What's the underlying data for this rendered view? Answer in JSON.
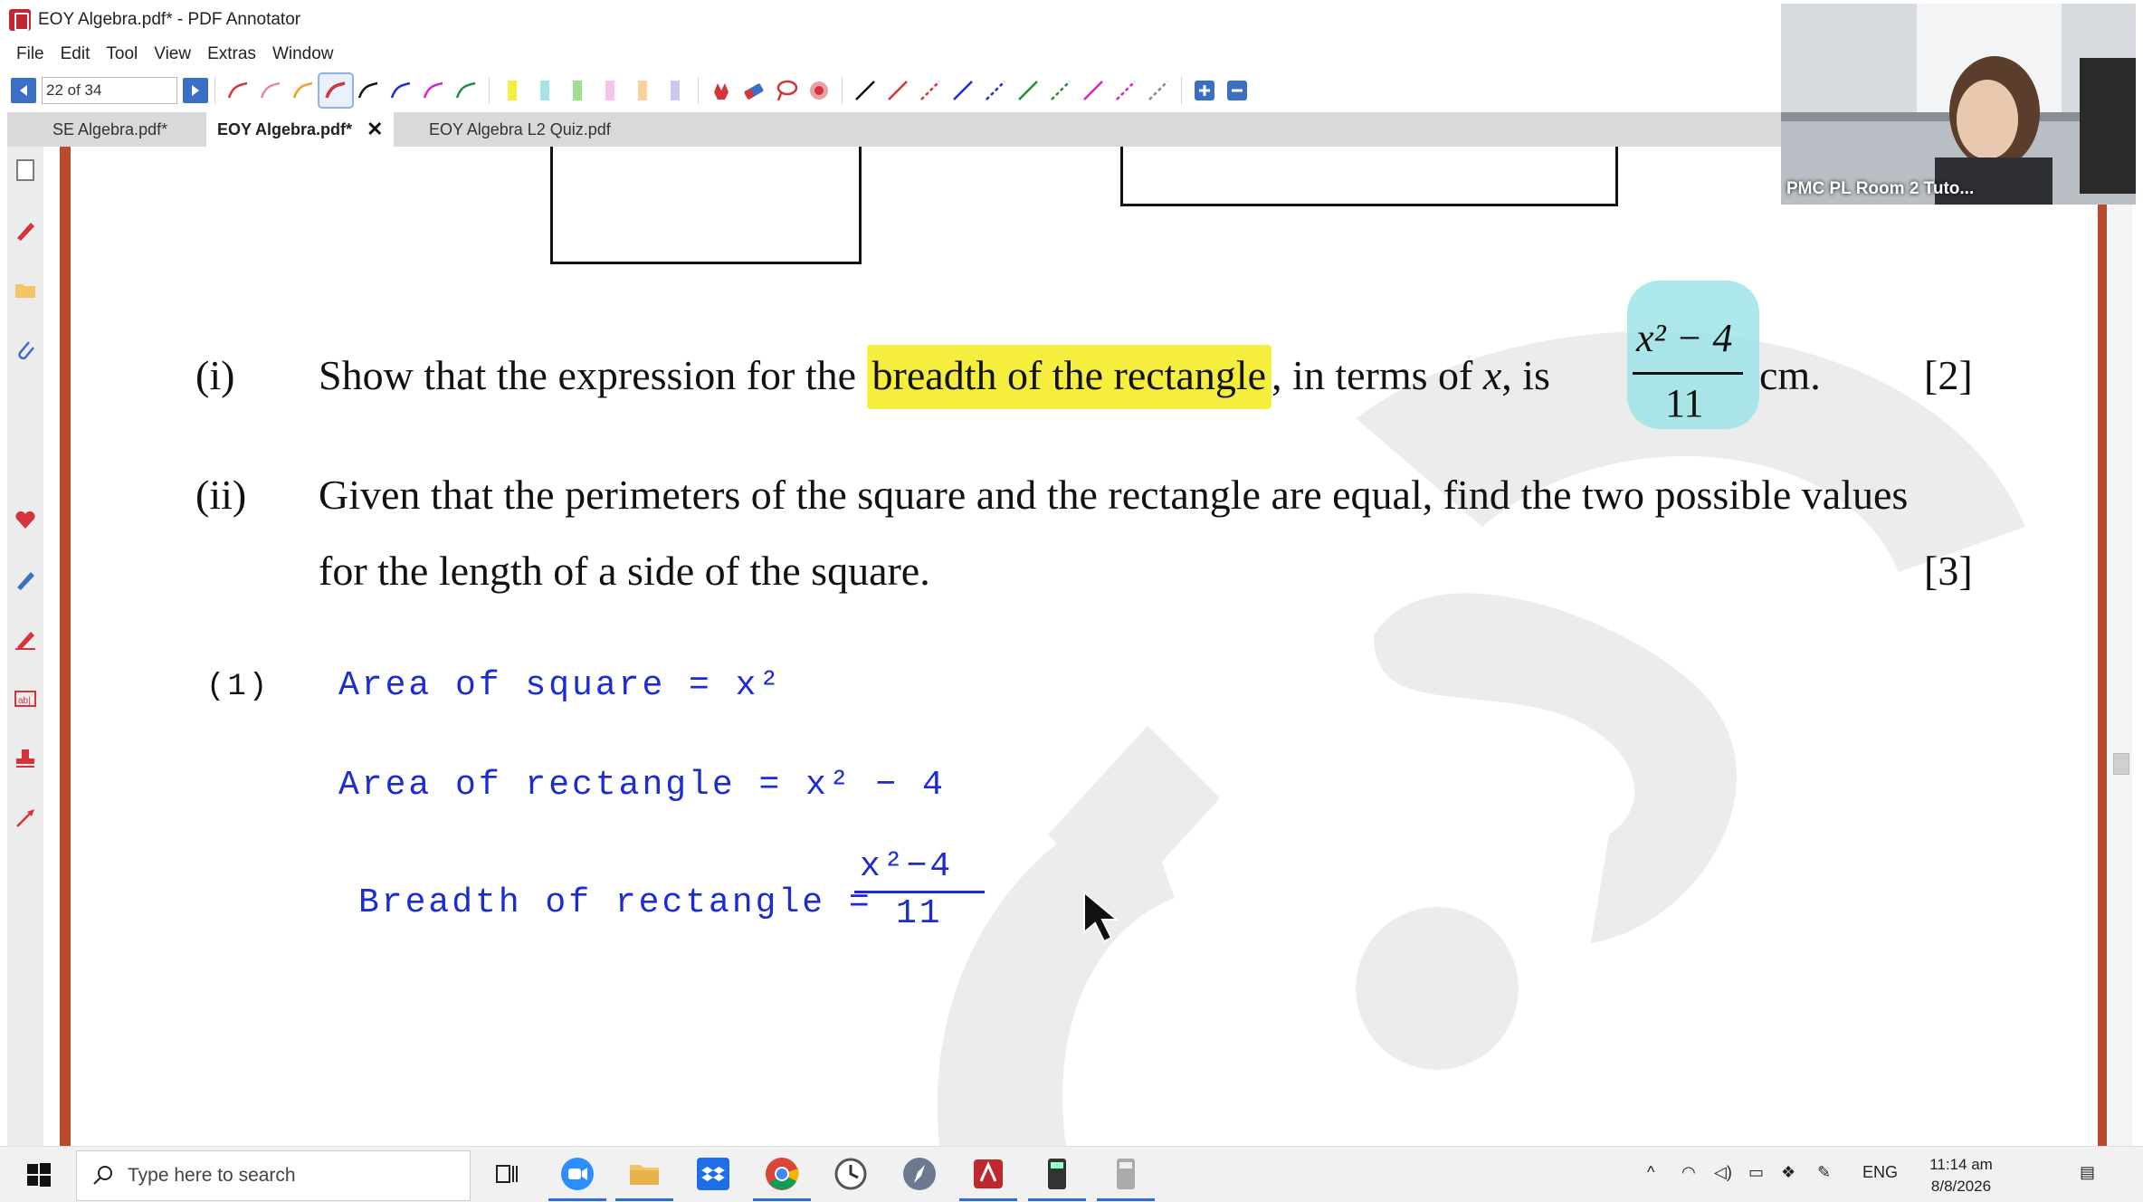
{
  "window": {
    "title": "EOY Algebra.pdf* - PDF Annotator"
  },
  "menu": [
    "File",
    "Edit",
    "Tool",
    "View",
    "Extras",
    "Window"
  ],
  "toolbar": {
    "page_field": "22 of 34"
  },
  "tabs": [
    {
      "label": "SE Algebra.pdf*"
    },
    {
      "label": "EOY Algebra.pdf*",
      "close": "✕"
    },
    {
      "label": "EOY Algebra L2 Quiz.pdf"
    }
  ],
  "document": {
    "q1_num": "(i)",
    "q1_pre": "Show that the expression for the ",
    "q1_highlight": "breadth of the rectangle",
    "q1_mid": ", in terms of ",
    "q1_var": "x",
    "q1_is": ", is",
    "q1_frac_num": "x² − 4",
    "q1_frac_den": "11",
    "q1_unit": "cm.",
    "q1_marks": "[2]",
    "q2_num": "(ii)",
    "q2_line1": "Given that the perimeters of the square and the rectangle are equal, find the two possible values",
    "q2_line2": "for the length of a side of the square.",
    "q2_marks": "[3]"
  },
  "handwriting": {
    "label": "(1)",
    "line1": "Area  of  square  =  x²",
    "line2": "Area  of  rectangle  =  x² − 4",
    "line3": "Breadth  of  rectangle  =",
    "frac_num": "x²−4",
    "frac_den": "11"
  },
  "webcam": {
    "label": "PMC PL Room 2 Tuto..."
  },
  "taskbar": {
    "search_placeholder": "Type here to search",
    "lang": "ENG",
    "time": "11:14 am",
    "date": "8/8/2026"
  },
  "colors": {
    "handwriting": "#1b2bd6",
    "highlight_yellow": "#f5ee3f",
    "highlight_cyan": "#9de4e8",
    "frame_red": "#b94a2c"
  }
}
